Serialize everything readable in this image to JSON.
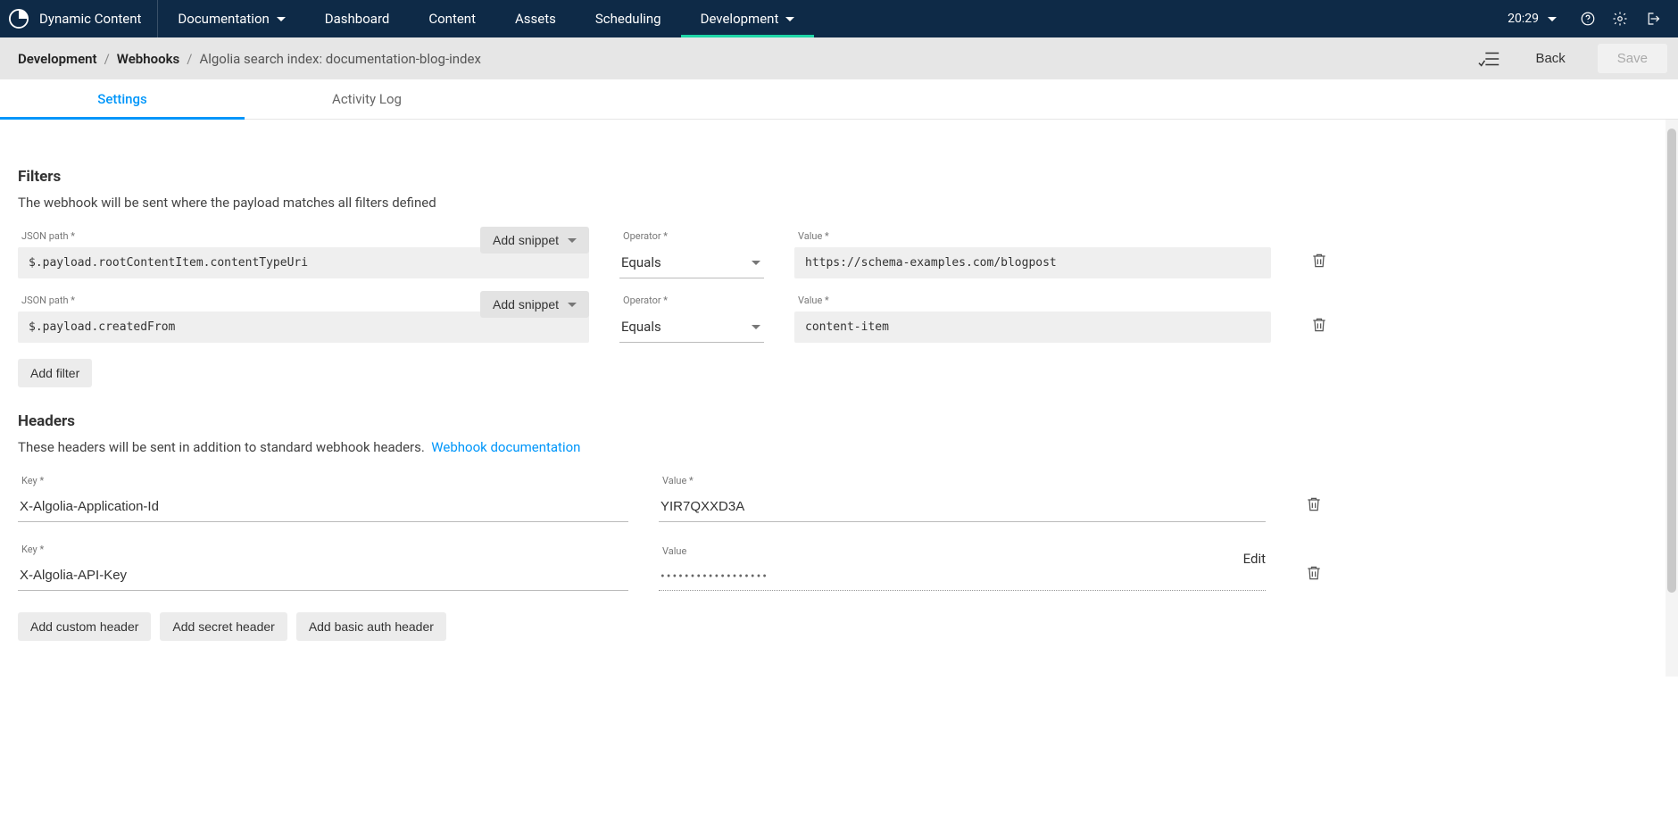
{
  "product_name": "Dynamic Content",
  "nav": {
    "documentation": "Documentation",
    "dashboard": "Dashboard",
    "content": "Content",
    "assets": "Assets",
    "scheduling": "Scheduling",
    "development": "Development"
  },
  "clock": "20:29",
  "breadcrumb": {
    "development": "Development",
    "webhooks": "Webhooks",
    "current": "Algolia search index: documentation-blog-index"
  },
  "subheader_buttons": {
    "back": "Back",
    "save": "Save"
  },
  "tabs": {
    "settings": "Settings",
    "activity_log": "Activity Log"
  },
  "filters": {
    "heading": "Filters",
    "desc": "The webhook will be sent where the payload matches all filters defined",
    "snippet_label": "Add snippet",
    "json_label": "JSON path *",
    "op_label": "Operator *",
    "val_label": "Value *",
    "rows": [
      {
        "json": "$.payload.rootContentItem.contentTypeUri",
        "op": "Equals",
        "value": "https://schema-examples.com/blogpost"
      },
      {
        "json": "$.payload.createdFrom",
        "op": "Equals",
        "value": "content-item"
      }
    ],
    "add_filter": "Add filter"
  },
  "headers": {
    "heading": "Headers",
    "desc": "These headers will be sent in addition to standard webhook headers.",
    "doc_link": "Webhook documentation",
    "key_label": "Key *",
    "val_label_req": "Value *",
    "val_label": "Value",
    "rows": [
      {
        "key": "X-Algolia-Application-Id",
        "value": "YIR7QXXD3A",
        "secret": false
      },
      {
        "key": "X-Algolia-API-Key",
        "value": "••••••••••••••••••",
        "secret": true
      }
    ],
    "edit": "Edit",
    "add_custom": "Add custom header",
    "add_secret": "Add secret header",
    "add_basic": "Add basic auth header"
  }
}
